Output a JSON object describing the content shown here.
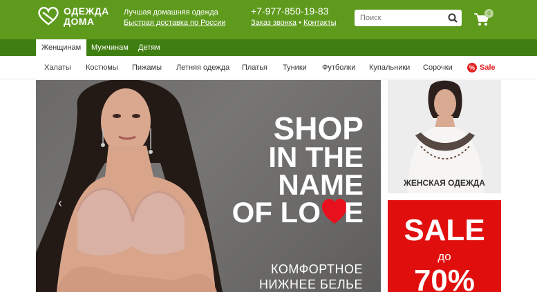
{
  "header": {
    "logo_line1": "ОДЕЖДА",
    "logo_line2": "ДОМА",
    "tagline": "Лучшая домашняя одежда",
    "delivery_link": "Быстрая доставка по России",
    "phone": "+7-977-850-19-83",
    "callback_link": "Заказ звонка",
    "contacts_link": "Контакты",
    "separator": "•",
    "search_placeholder": "Поиск",
    "cart_count": "0",
    "colors": {
      "header_bg": "#5e9a1c",
      "tabbar_bg": "#3f7e10"
    }
  },
  "tabs": [
    {
      "label": "Женщинам",
      "active": true
    },
    {
      "label": "Мужчинам",
      "active": false
    },
    {
      "label": "Детям",
      "active": false
    }
  ],
  "categories": [
    "Халаты",
    "Костюмы",
    "Пижамы",
    "Летняя одежда",
    "Платья",
    "Туники",
    "Футболки",
    "Купальники",
    "Сорочки"
  ],
  "sale_category": {
    "icon_text": "%",
    "label": "Sale",
    "color": "#e32121"
  },
  "hero": {
    "headline_lines": [
      "SHOP",
      "IN THE",
      "NAME",
      "OF LO",
      "E"
    ],
    "subline1": "КОМФОРТНОЕ",
    "subline2": "НИЖНЕЕ БЕЛЬЕ",
    "prev_icon": "‹"
  },
  "side_promo": {
    "label": "ЖЕНСКАЯ ОДЕЖДА"
  },
  "sale_promo": {
    "title": "SALE",
    "middle": "до",
    "percent": "70%",
    "color": "#e10e0e"
  }
}
